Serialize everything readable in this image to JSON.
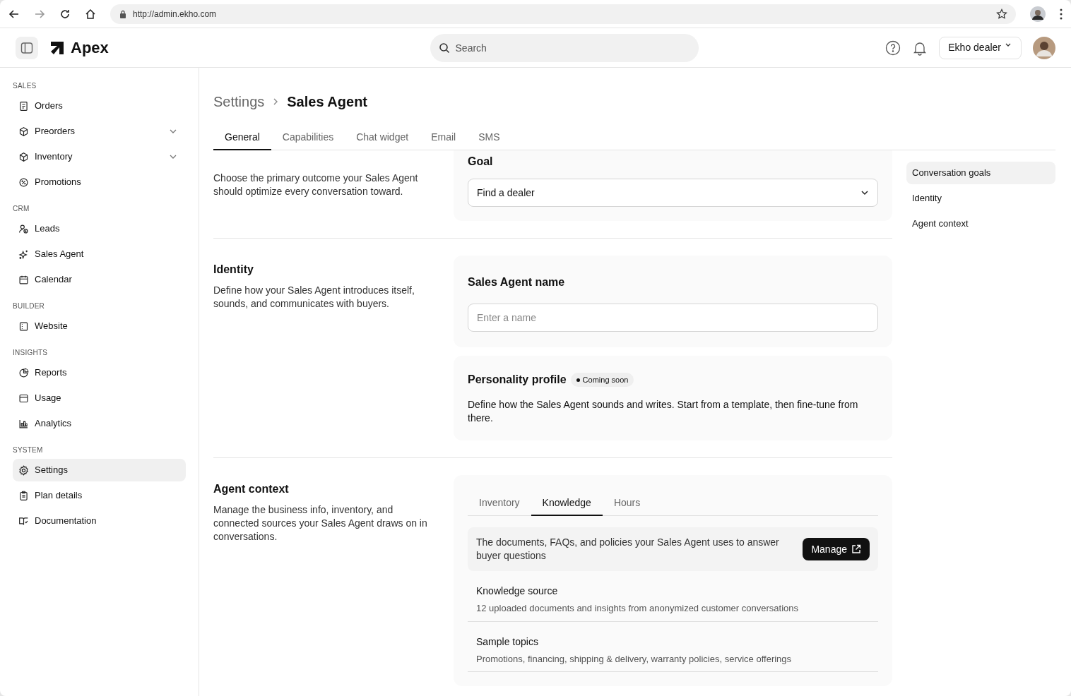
{
  "browser": {
    "url": "http://admin.ekho.com"
  },
  "header": {
    "brand": "Apex",
    "search": {
      "placeholder": "Search"
    },
    "account": "Ekho dealer"
  },
  "sidebar": {
    "sections": [
      {
        "title": "SALES",
        "items": [
          {
            "label": "Orders",
            "expandable": false,
            "selected": false
          },
          {
            "label": "Preorders",
            "expandable": true,
            "selected": false
          },
          {
            "label": "Inventory",
            "expandable": true,
            "selected": false
          },
          {
            "label": "Promotions",
            "expandable": false,
            "selected": false
          }
        ]
      },
      {
        "title": "CRM",
        "items": [
          {
            "label": "Leads",
            "expandable": false,
            "selected": false
          },
          {
            "label": "Sales Agent",
            "expandable": false,
            "selected": false
          },
          {
            "label": "Calendar",
            "expandable": false,
            "selected": false
          }
        ]
      },
      {
        "title": "BUILDER",
        "items": [
          {
            "label": "Website",
            "expandable": false,
            "selected": false
          }
        ]
      },
      {
        "title": "INSIGHTS",
        "items": [
          {
            "label": "Reports",
            "expandable": false,
            "selected": false
          },
          {
            "label": "Usage",
            "expandable": false,
            "selected": false
          },
          {
            "label": "Analytics",
            "expandable": false,
            "selected": false
          }
        ]
      },
      {
        "title": "SYSTEM",
        "items": [
          {
            "label": "Settings",
            "expandable": false,
            "selected": true
          },
          {
            "label": "Plan details",
            "expandable": false,
            "selected": false
          },
          {
            "label": "Documentation",
            "expandable": false,
            "selected": false
          }
        ]
      }
    ]
  },
  "breadcrumb": {
    "parent": "Settings",
    "current": "Sales Agent"
  },
  "tabs": [
    {
      "label": "General",
      "selected": true
    },
    {
      "label": "Capabilities",
      "selected": false
    },
    {
      "label": "Chat widget",
      "selected": false
    },
    {
      "label": "Email",
      "selected": false
    },
    {
      "label": "SMS",
      "selected": false
    }
  ],
  "sections": [
    {
      "description": "Choose the primary outcome your Sales Agent should optimize every conversation toward.",
      "cards": [
        {
          "kind": "select",
          "title": "Goal",
          "value": "Find a dealer"
        }
      ]
    },
    {
      "title": "Identity",
      "description": "Define how your Sales Agent introduces itself, sounds, and communicates with buyers.",
      "cards": [
        {
          "kind": "input",
          "title": "Sales Agent name",
          "placeholder": "Enter a name"
        },
        {
          "kind": "text",
          "title": "Personality profile",
          "badge": "Coming soon",
          "body": "Define how the Sales Agent sounds and writes. Start from a template, then fine-tune from there."
        }
      ]
    },
    {
      "title": "Agent context",
      "description": "Manage the business info, inventory, and connected sources your Sales Agent draws on in conversations.",
      "cards": [
        {
          "kind": "tabs",
          "tabs": [
            {
              "label": "Inventory",
              "selected": false
            },
            {
              "label": "Knowledge",
              "selected": true
            },
            {
              "label": "Hours",
              "selected": false
            }
          ],
          "notice": "The documents, FAQs, and policies your Sales Agent uses to answer buyer questions",
          "button": "Manage",
          "rows": [
            {
              "title": "Knowledge source",
              "detail": "12 uploaded documents and insights from anonymized customer conversations"
            },
            {
              "title": "Sample topics",
              "detail": "Promotions, financing, shipping & delivery, warranty policies, service offerings"
            }
          ]
        }
      ]
    }
  ],
  "toc": [
    {
      "label": "Conversation goals",
      "selected": true
    },
    {
      "label": "Identity",
      "selected": false
    },
    {
      "label": "Agent context",
      "selected": false
    }
  ]
}
